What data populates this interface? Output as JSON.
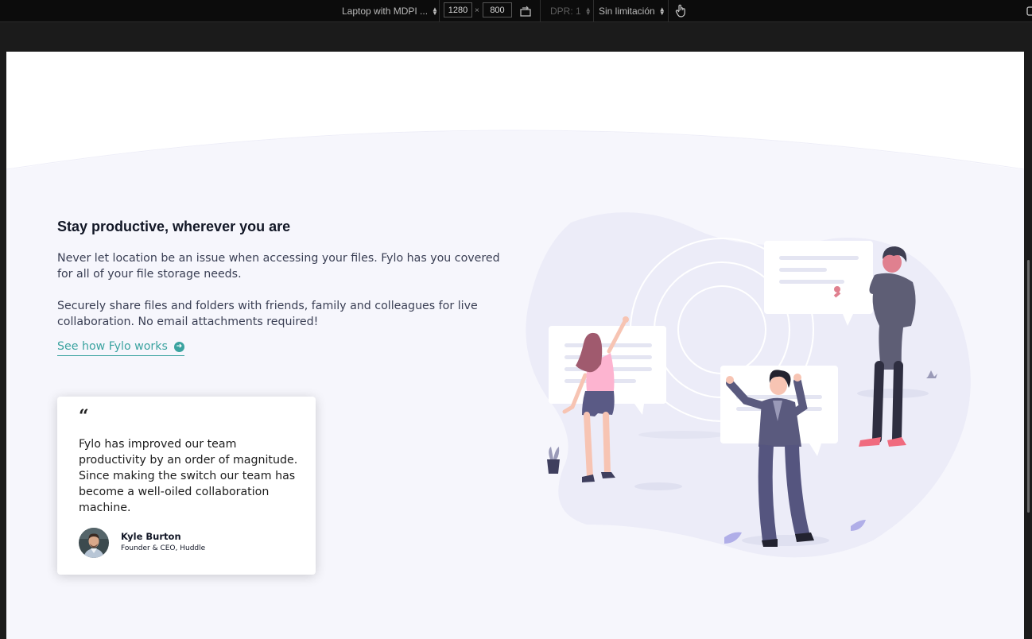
{
  "devtools": {
    "device_label": "Laptop with MDPI ...",
    "width_value": "1280",
    "times_sign": "×",
    "height_value": "800",
    "dpr_label": "DPR: 1",
    "throttle_label": "Sin limitación"
  },
  "feature": {
    "title": "Stay productive, wherever you are",
    "paragraph_1": "Never let location be an issue when accessing your files. Fylo has you covered for all of your file storage needs.",
    "paragraph_2": "Securely share files and folders with friends, family and colleagues for live collaboration. No email attachments required!",
    "link_label": "See how Fylo works",
    "link_arrow": "➜"
  },
  "testimonial": {
    "quote_mark": "“",
    "quote": "Fylo has improved our team productivity by an order of magnitude. Since making the switch our team has become a well-oiled collaboration machine.",
    "name": "Kyle Burton",
    "role": "Founder & CEO, Huddle"
  },
  "colors": {
    "accent": "#3ba3a0",
    "section_bg": "#f6f6fc",
    "heading": "#121726",
    "toolbar_bg": "#0c0c0c"
  }
}
